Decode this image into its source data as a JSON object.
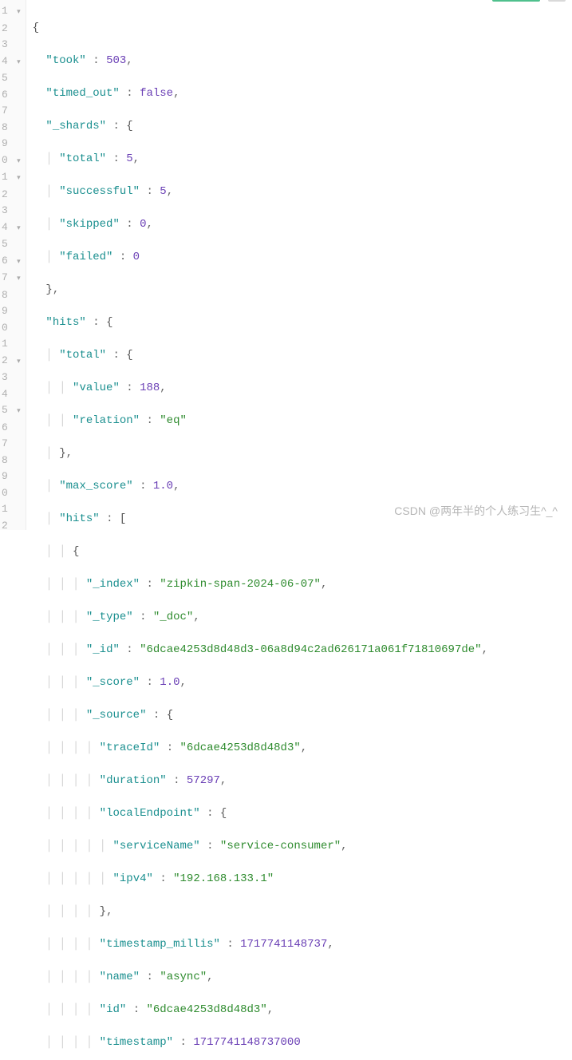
{
  "gutter": {
    "start": 1,
    "count": 32,
    "fold_lines": [
      1,
      4,
      10,
      11,
      14,
      16,
      17,
      22,
      25
    ]
  },
  "json": {
    "took_key": "\"took\"",
    "took_val": "503",
    "timed_out_key": "\"timed_out\"",
    "timed_out_val": "false",
    "shards_key": "\"_shards\"",
    "shards_total_key": "\"total\"",
    "shards_total_val": "5",
    "shards_successful_key": "\"successful\"",
    "shards_successful_val": "5",
    "shards_skipped_key": "\"skipped\"",
    "shards_skipped_val": "0",
    "shards_failed_key": "\"failed\"",
    "shards_failed_val": "0",
    "hits_key": "\"hits\"",
    "hits_total_key": "\"total\"",
    "hits_total_value_key": "\"value\"",
    "hits_total_value_val": "188",
    "hits_total_relation_key": "\"relation\"",
    "hits_total_relation_val": "\"eq\"",
    "max_score_key": "\"max_score\"",
    "max_score_val": "1.0",
    "hits_arr_key": "\"hits\"",
    "index_key": "\"_index\"",
    "index_val": "\"zipkin-span-2024-06-07\"",
    "type_key": "\"_type\"",
    "type_val": "\"_doc\"",
    "id_key": "\"_id\"",
    "id_val": "\"6dcae4253d8d48d3-06a8d94c2ad626171a061f71810697de\"",
    "score_key": "\"_score\"",
    "score_val": "1.0",
    "source_key": "\"_source\"",
    "traceId_key": "\"traceId\"",
    "traceId_val": "\"6dcae4253d8d48d3\"",
    "duration_key": "\"duration\"",
    "duration_val": "57297",
    "localEndpoint_key": "\"localEndpoint\"",
    "serviceName_key": "\"serviceName\"",
    "serviceName_val": "\"service-consumer\"",
    "ipv4_key": "\"ipv4\"",
    "ipv4_val": "\"192.168.133.1\"",
    "timestamp_millis_key": "\"timestamp_millis\"",
    "timestamp_millis_val": "1717741148737",
    "name_key": "\"name\"",
    "name_val": "\"async\"",
    "src_id_key": "\"id\"",
    "src_id_val": "\"6dcae4253d8d48d3\"",
    "timestamp_key": "\"timestamp\"",
    "timestamp_val": "1717741148737000"
  },
  "watermark": "CSDN @两年半的个人练习生^_^"
}
